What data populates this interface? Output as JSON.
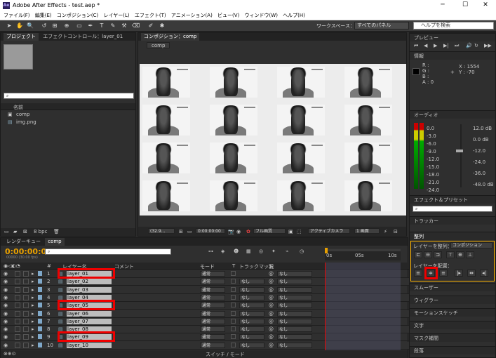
{
  "app": {
    "title": "Adobe After Effects - test.aep *",
    "logo": "Ae"
  },
  "window": {
    "minimize": "─",
    "maximize": "☐",
    "close": "✕"
  },
  "menu": [
    "ファイル(F)",
    "編集(E)",
    "コンポジション(C)",
    "レイヤー(L)",
    "エフェクト(T)",
    "アニメーション(A)",
    "ビュー(V)",
    "ウィンドウ(W)",
    "ヘルプ(H)"
  ],
  "toolbar": {
    "workspace_label": "ワークスペース：",
    "workspace_value": "すべてのパネル",
    "help_placeholder": "ヘルプを検索"
  },
  "project": {
    "tabs": [
      "プロジェクト",
      "エフェクトコントロール：layer_01"
    ],
    "name_header": "名前",
    "items": [
      "comp",
      "img.png"
    ],
    "bpc": "8 bpc"
  },
  "comp_viewer": {
    "tab": "コンポジション：comp",
    "subtab": "comp",
    "zoom": "(32.9...",
    "timecode": "0:00:00:00",
    "resolution": "フル画質",
    "camera": "アクティブカメラ",
    "views": "1 画面"
  },
  "right_panels": {
    "preview": "プレビュー",
    "info": "情報",
    "info_values": {
      "r": "R :",
      "g": "G :",
      "b": "B :",
      "a": "A : 0",
      "x": "X : 1554",
      "y": "Y : -70"
    },
    "audio": "オーディオ",
    "audio_left": [
      "0.0",
      "-3.0",
      "-6.0",
      "-9.0",
      "-12.0",
      "-15.0",
      "-18.0",
      "-21.0",
      "-24.0"
    ],
    "audio_right": [
      "12.0 dB",
      "0.0 dB",
      "-12.0",
      "-24.0",
      "-36.0",
      "-48.0 dB"
    ],
    "effects": "エフェクト＆プリセット",
    "tracker": "トラッカー",
    "align": "整列",
    "align_to_label": "レイヤーを整列：",
    "align_to_value": "コンポジション",
    "distribute_label": "レイヤーを配置：",
    "smoother": "スムーザー",
    "wiggler": "ウィグラー",
    "motion_sketch": "モーションスケッチ",
    "character": "文字",
    "mask": "マスク補間",
    "paragraph": "段落"
  },
  "timeline": {
    "tabs": [
      "レンダーキュー",
      "comp"
    ],
    "timecode": "0:00:00:00",
    "fps": "00000 (30.00 fps)",
    "headers": {
      "num": "#",
      "name": "レイヤー名",
      "comment": "コメント",
      "mode": "モード",
      "t": "T",
      "trkmat": "トラックマット",
      "parent": "親"
    },
    "ruler": [
      "0s",
      "05s",
      "10s"
    ],
    "switch_label": "スイッチ / モード",
    "layers": [
      {
        "num": "1",
        "name": "layer_01",
        "mode": "通常",
        "trk": "",
        "parent": "なし"
      },
      {
        "num": "2",
        "name": "layer_02",
        "mode": "通常",
        "trk": "なし",
        "parent": "なし"
      },
      {
        "num": "3",
        "name": "layer_03",
        "mode": "通常",
        "trk": "なし",
        "parent": "なし"
      },
      {
        "num": "4",
        "name": "layer_04",
        "mode": "通常",
        "trk": "なし",
        "parent": "なし"
      },
      {
        "num": "5",
        "name": "layer_05",
        "mode": "通常",
        "trk": "なし",
        "parent": "なし"
      },
      {
        "num": "6",
        "name": "layer_06",
        "mode": "通常",
        "trk": "なし",
        "parent": "なし"
      },
      {
        "num": "7",
        "name": "layer_07",
        "mode": "通常",
        "trk": "なし",
        "parent": "なし"
      },
      {
        "num": "8",
        "name": "layer_08",
        "mode": "通常",
        "trk": "なし",
        "parent": "なし"
      },
      {
        "num": "9",
        "name": "layer_09",
        "mode": "通常",
        "trk": "なし",
        "parent": "なし"
      },
      {
        "num": "10",
        "name": "layer_10",
        "mode": "通常",
        "trk": "なし",
        "parent": "なし"
      }
    ]
  },
  "colors": {
    "timecode": "#e8a000",
    "highlight": "#e00000",
    "accent": "#ffb400"
  }
}
